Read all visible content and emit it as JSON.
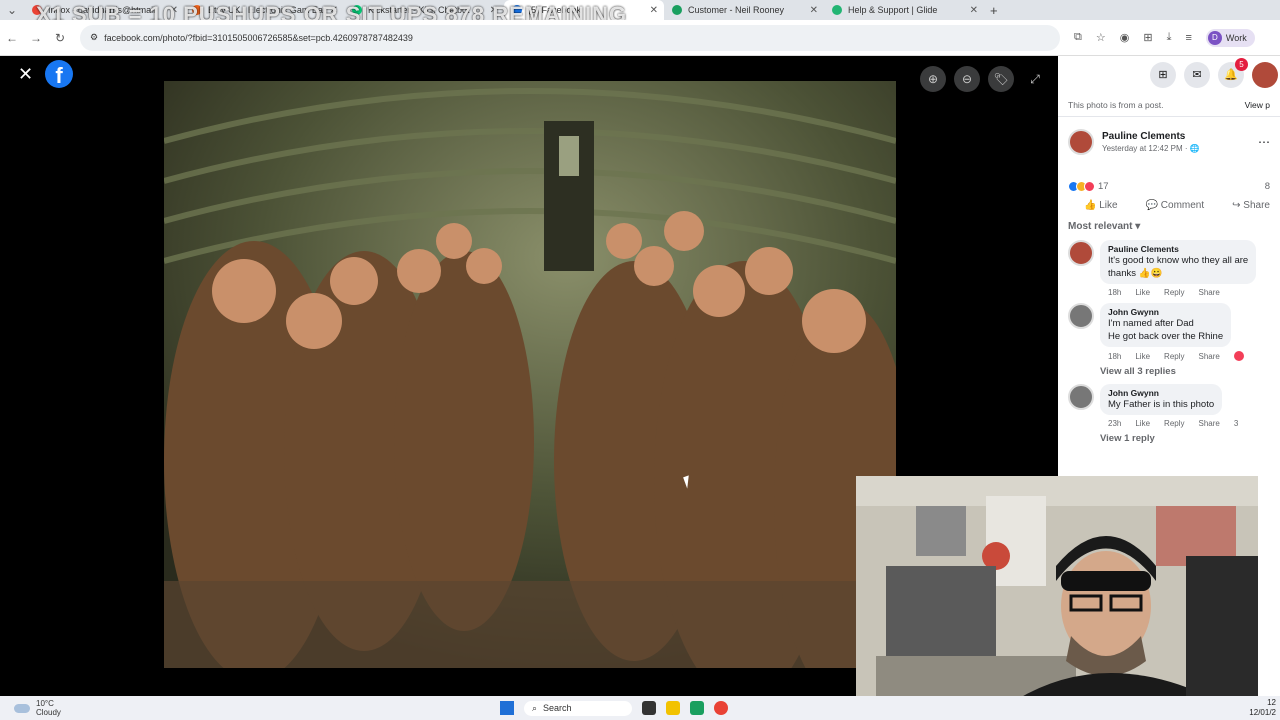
{
  "browser": {
    "tabs": [
      {
        "label": "Inbox - davidharris@htmail",
        "color": "#ea4335",
        "active": false
      },
      {
        "label": "Etsy UK | Electronic Gam Ear",
        "color": "#f1641e",
        "active": false
      },
      {
        "label": "Kickstarter - Kick Chatbot",
        "color": "#05ce78",
        "active": false
      },
      {
        "label": "(5) Facebook",
        "color": "#1877f2",
        "active": true
      },
      {
        "label": "Customer - Neil Rooney",
        "color": "#1a9f5f",
        "active": false
      },
      {
        "label": "Help & Support | Glide",
        "color": "#22b573",
        "active": false
      }
    ],
    "new_tab": "+",
    "overlay_text": "X1 SUB = 10 PUSHUPS OR SIT UPS 878 REMAINING",
    "url": "facebook.com/photo/?fbid=3101505006726585&set=pcb.4260978787482439",
    "profile_letter": "D",
    "profile_label": "Work"
  },
  "viewer": {
    "close": "✕",
    "logo": "f",
    "tools": [
      "⊕",
      "⊖",
      "🏷",
      "⤢"
    ]
  },
  "panel": {
    "notification_count": "5",
    "from_post": "This photo is from a post.",
    "view_post": "View p",
    "author": "Pauline Clements",
    "time": "Yesterday at 12:42 PM · ",
    "reaction_count": "17",
    "reaction_count_right": "8",
    "like": "Like",
    "comment": "Comment",
    "share": "Share",
    "sort": "Most relevant ▾",
    "comments": [
      {
        "name": "Pauline Clements",
        "lines": [
          "It's good to know who they all are",
          "thanks 👍😀"
        ],
        "time": "18h",
        "like": "Like",
        "reply": "Reply",
        "share": "Share",
        "heart": false,
        "replies": ""
      },
      {
        "name": "John Gwynn",
        "lines": [
          "I'm named after Dad",
          "He got back over the Rhine"
        ],
        "time": "18h",
        "like": "Like",
        "reply": "Reply",
        "share": "Share",
        "heart": true,
        "replies": "View all 3 replies"
      },
      {
        "name": "John Gwynn",
        "lines": [
          "My Father is in this photo",
          ""
        ],
        "time": "23h",
        "like": "Like",
        "reply": "Reply",
        "share": "Share",
        "heart": true,
        "replies": "View 1 reply",
        "react_count": "3"
      }
    ]
  },
  "taskbar": {
    "temp": "10°C",
    "condition": "Cloudy",
    "search": "Search",
    "time": "12",
    "date": "12/01/2"
  }
}
